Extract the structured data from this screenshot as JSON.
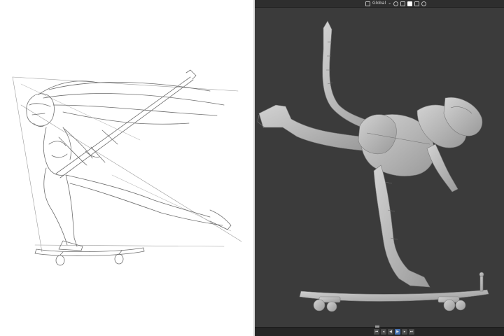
{
  "viewport_header": {
    "transform_orientation_label": "Global",
    "icons": [
      "transform-orientation-icon",
      "pivot-icon",
      "snap-icon",
      "proportional-edit-icon",
      "overlay-icon",
      "shading-icon"
    ]
  },
  "timeline": {
    "buttons": [
      "jump-start",
      "prev-keyframe",
      "play-reverse",
      "play",
      "next-keyframe",
      "jump-end"
    ]
  },
  "colors": {
    "viewport_background": "#3b3b3b",
    "header_background": "#2e2e2e",
    "timeline_background": "#262626",
    "model_clay": "#b8b8b8",
    "sketch_line": "#6e6e6e",
    "active_accent": "#4772b3"
  }
}
